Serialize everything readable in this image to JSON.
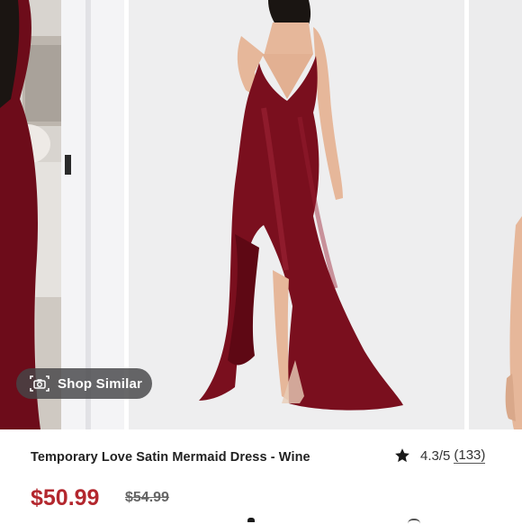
{
  "gallery": {
    "shop_similar_label": "Shop Similar",
    "dress_color": "#7a0f1e"
  },
  "product": {
    "title": "Temporary Love Satin Mermaid Dress - Wine",
    "rating": "4.3/5",
    "review_count": "(133)",
    "price": "$50.99",
    "original_price": "$54.99",
    "price_color": "#b3272e"
  },
  "icons": {
    "camera": "camera-icon",
    "star": "star-icon"
  }
}
